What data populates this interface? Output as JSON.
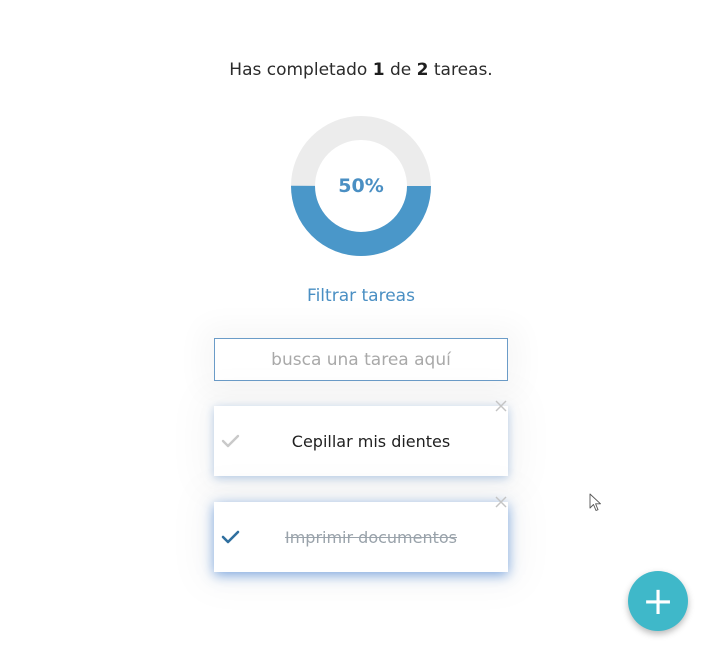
{
  "summary": {
    "prefix": "Has completado",
    "completed": "1",
    "middle": "de",
    "total": "2",
    "suffix": "tareas."
  },
  "progress": {
    "percent_label": "50%",
    "fraction": 0.5,
    "fill_color": "#4a97c9",
    "track_color": "#ececec"
  },
  "filter": {
    "title": "Filtrar tareas",
    "placeholder": "busca una tarea aquí",
    "value": ""
  },
  "todos": [
    {
      "text": "Cepillar mis dientes",
      "completed": false
    },
    {
      "text": "Imprimir documentos",
      "completed": true
    }
  ],
  "icons": {
    "check": "check-icon",
    "delete": "close-icon",
    "add": "plus-icon"
  },
  "add_button": {
    "label": "+",
    "color": "#3fb8c9"
  }
}
